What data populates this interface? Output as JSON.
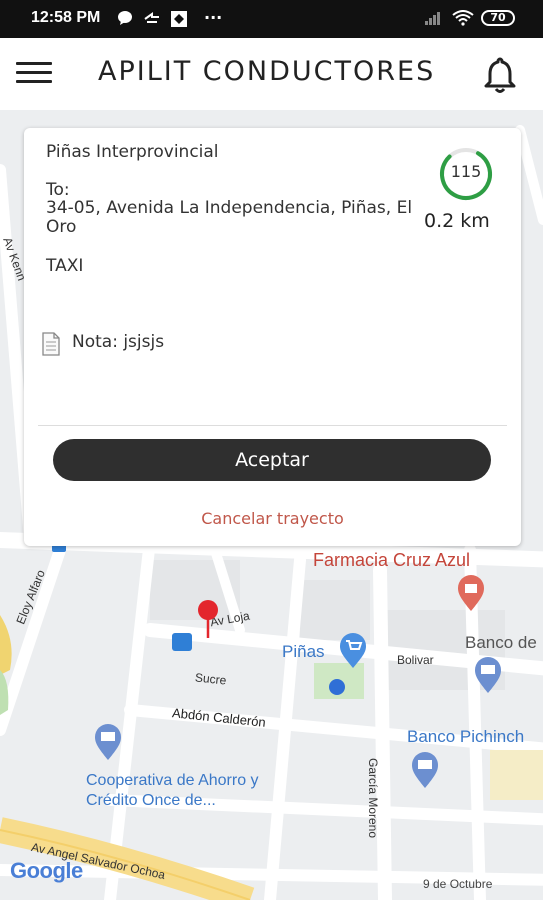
{
  "status_bar": {
    "time": "12:58 PM",
    "battery": "70",
    "icons": [
      "chat-icon",
      "sync-icon",
      "sim-icon",
      "more-icon",
      "signal-icon",
      "wifi-icon",
      "battery-icon"
    ]
  },
  "app_bar": {
    "title": "APILIT CONDUCTORES",
    "menu_icon": "hamburger-menu-icon",
    "notification_icon": "bell-icon"
  },
  "trip": {
    "origin": "Piñas Interprovincial",
    "to_label": "To:",
    "destination": "34-05,  Avenida La Independencia, Piñas, El Oro",
    "service_type": "TAXI",
    "note": "Nota: jsjsjs",
    "countdown": "115",
    "distance": "0.2 km",
    "accept_label": "Aceptar",
    "cancel_label": "Cancelar trayecto",
    "accent_color": "#2e9e44",
    "cancel_color": "#c0574a"
  },
  "map": {
    "labels": {
      "farmacia": "Farmacia Cruz Azul",
      "pinas": "Piñas",
      "banco_de": "Banco de",
      "bolivar": "Bolivar",
      "av_loja": "Av Loja",
      "sucre": "Sucre",
      "abdon": "Abdón Calderón",
      "banco_pichincha": "Banco Pichinch",
      "cooperativa": "Cooperativa de Ahorro y Crédito Once de...",
      "garcia_moreno": "García Moreno",
      "eloy_alfaro": "Eloy Alfaro",
      "av_kennedy": "Av Kenn",
      "av_angel": "Av Angel Salvador Ochoa",
      "nueve_octubre": "9 de Octubre",
      "google": "Google"
    }
  }
}
